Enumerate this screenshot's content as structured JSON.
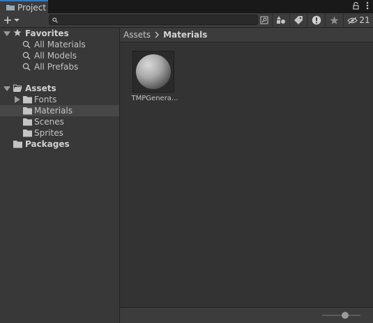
{
  "window": {
    "tab_title": "Project"
  },
  "toolbar": {
    "search": {
      "value": "",
      "placeholder": ""
    },
    "hidden_count": "21"
  },
  "sidebar": {
    "favorites": {
      "label": "Favorites",
      "items": [
        {
          "label": "All Materials"
        },
        {
          "label": "All Models"
        },
        {
          "label": "All Prefabs"
        }
      ]
    },
    "assets": {
      "label": "Assets",
      "children": [
        {
          "label": "Fonts",
          "expandable": true
        },
        {
          "label": "Materials",
          "selected": true
        },
        {
          "label": "Scenes"
        },
        {
          "label": "Sprites"
        }
      ]
    },
    "packages": {
      "label": "Packages"
    }
  },
  "breadcrumb": {
    "root": "Assets",
    "separator": ">",
    "current": "Materials"
  },
  "assets": [
    {
      "name": "TMPGenera...",
      "icon": "material-sphere-icon"
    }
  ],
  "footer": {
    "zoom_slider": 0.6
  },
  "colors": {
    "accent": "#3a79bb",
    "selection": "#474747"
  }
}
